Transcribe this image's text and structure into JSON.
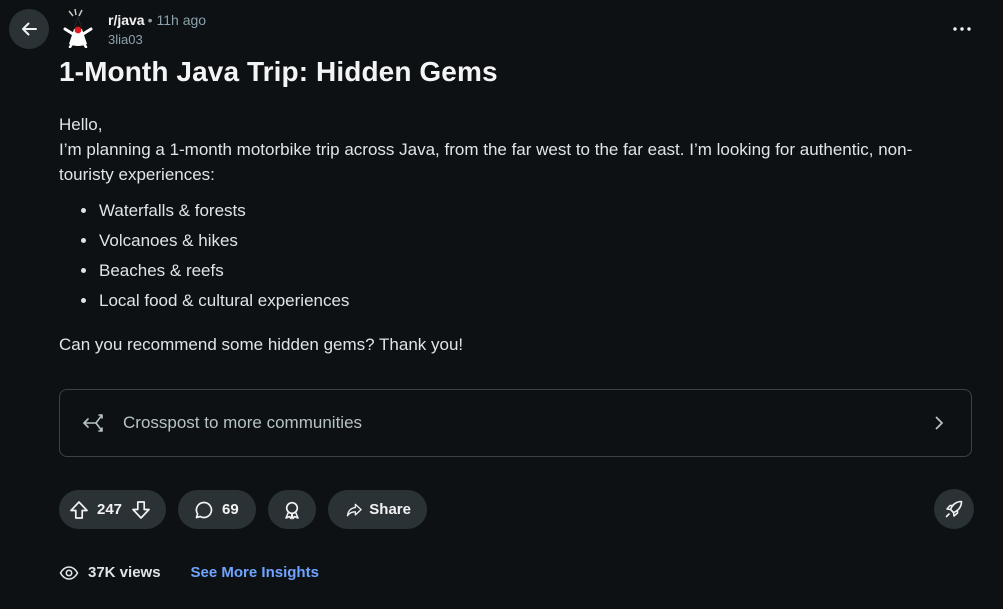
{
  "header": {
    "subreddit": "r/java",
    "separator": "•",
    "time_ago": "11h ago",
    "username": "3lia03"
  },
  "post": {
    "title": "1-Month Java Trip: Hidden Gems",
    "greeting": "Hello,",
    "intro": "I’m planning a 1-month motorbike trip across Java, from the far west to the far east. I’m looking for authentic, non-touristy experiences:",
    "bullets": [
      "Waterfalls & forests",
      "Volcanoes & hikes",
      "Beaches & reefs",
      "Local food & cultural experiences"
    ],
    "closing": "Can you recommend some hidden gems? Thank you!"
  },
  "crosspost": {
    "label": "Crosspost to more communities"
  },
  "actions": {
    "score": "247",
    "comments": "69",
    "share_label": "Share"
  },
  "insights": {
    "views": "37K views",
    "link": "See More Insights"
  },
  "colors": {
    "background": "#0e1113",
    "pill": "#2a3236",
    "link": "#6ea4ff",
    "muted": "#8ba2ad"
  }
}
